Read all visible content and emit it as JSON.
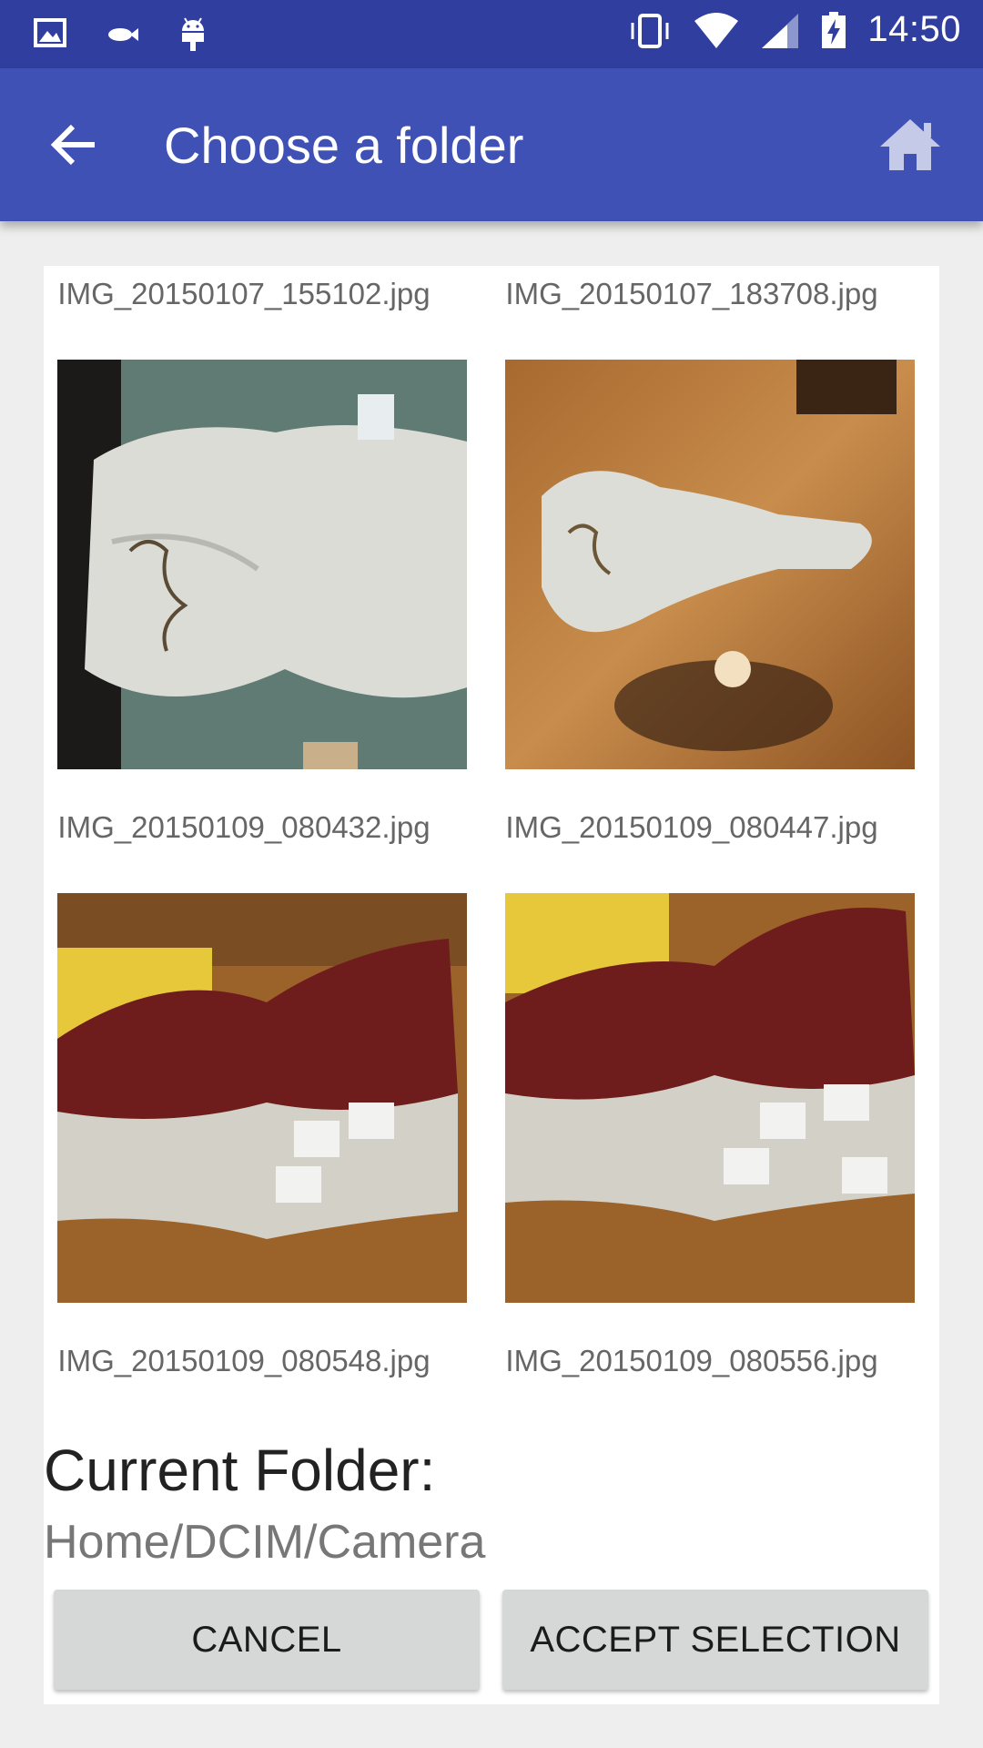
{
  "status_bar": {
    "time": "14:50",
    "left_icons": [
      "image-icon",
      "fish-icon",
      "android-icon"
    ],
    "right_icons": [
      "vibrate-icon",
      "wifi-icon",
      "signal-icon",
      "battery-charging-icon"
    ]
  },
  "app_bar": {
    "title": "Choose a folder",
    "back_icon": "arrow-back-icon",
    "home_icon": "home-icon",
    "color": "#3f51b5",
    "status_color": "#303f9f"
  },
  "files": {
    "top_row": [
      "IMG_20150107_155102.jpg",
      "IMG_20150107_183708.jpg"
    ],
    "items": [
      {
        "name": "IMG_20150109_080432.jpg"
      },
      {
        "name": "IMG_20150109_080447.jpg"
      },
      {
        "name": "IMG_20150109_080548.jpg"
      },
      {
        "name": "IMG_20150109_080556.jpg"
      }
    ]
  },
  "folder": {
    "label": "Current Folder:",
    "path": "Home/DCIM/Camera"
  },
  "buttons": {
    "cancel": "CANCEL",
    "accept": "ACCEPT SELECTION"
  }
}
